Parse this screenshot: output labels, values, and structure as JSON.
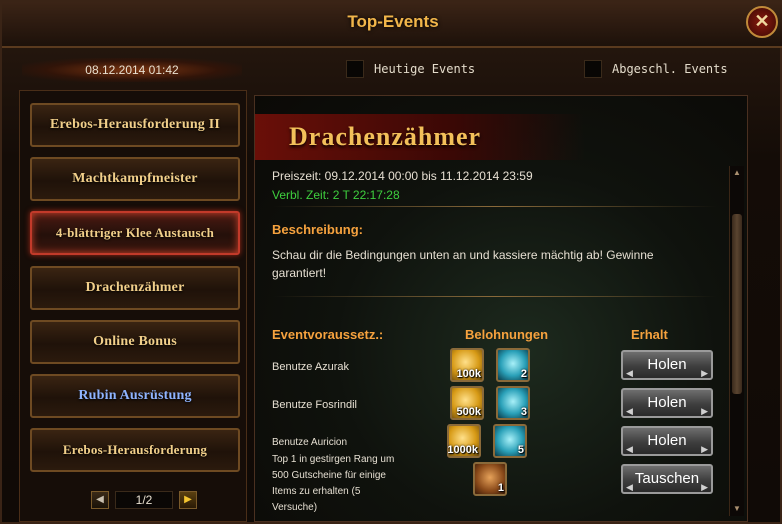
{
  "window": {
    "title": "Top-Events",
    "close": "✕"
  },
  "header": {
    "datetime": "08.12.2014 01:42",
    "filter_today": "Heutige Events",
    "filter_finished": "Abgeschl. Events"
  },
  "sidebar": {
    "items": [
      {
        "label": "Erebos-Herausforderung II",
        "selected": false
      },
      {
        "label": "Machtkampfmeister",
        "selected": false
      },
      {
        "label": "4-blättriger Klee Austausch",
        "selected": true
      },
      {
        "label": "Drachenzähmer",
        "selected": false
      },
      {
        "label": "Online Bonus",
        "selected": false
      },
      {
        "label": "Rubin Ausrüstung",
        "selected": false
      },
      {
        "label": "Erebos-Herausforderung",
        "selected": false
      }
    ],
    "pager": {
      "page": "1/2",
      "prev": "◀",
      "next": "▶"
    }
  },
  "event": {
    "title": "Drachenzähmer",
    "prize_time": "Preiszeit: 09.12.2014 00:00 bis 11.12.2014 23:59",
    "remaining": "Verbl. Zeit: 2 T  22:17:28",
    "desc_heading": "Beschreibung:",
    "description_line1": "Schau dir die Bedingungen unten an und kassiere mächtig ab! Gewinne",
    "description_line2": "garantiert!",
    "columns": {
      "condition": "Eventvoraussetz.:",
      "rewards": "Belohnungen",
      "receive": "Erhalt"
    },
    "rows": [
      {
        "condition": "Benutze Azurak",
        "coin": "100k",
        "gem": "2",
        "button": "Holen"
      },
      {
        "condition": "Benutze Fosrindil",
        "coin": "500k",
        "gem": "3",
        "button": "Holen"
      },
      {
        "condition": "Benutze Auricion",
        "coin": "1000k",
        "gem": "5",
        "button": "Holen"
      }
    ],
    "rank_row": {
      "line1": "Top 1 in gestirgen Rang um",
      "line2": "500 Gutscheine für einige",
      "line3": "Items zu erhalten (5",
      "line4": "Versuche)",
      "item_count": "1",
      "button": "Tauschen"
    }
  },
  "colors": {
    "title_gold": "#f2b64a",
    "green": "#3ecf3e",
    "orange": "#f6a23e",
    "blue_item": "#8fb4ff"
  }
}
